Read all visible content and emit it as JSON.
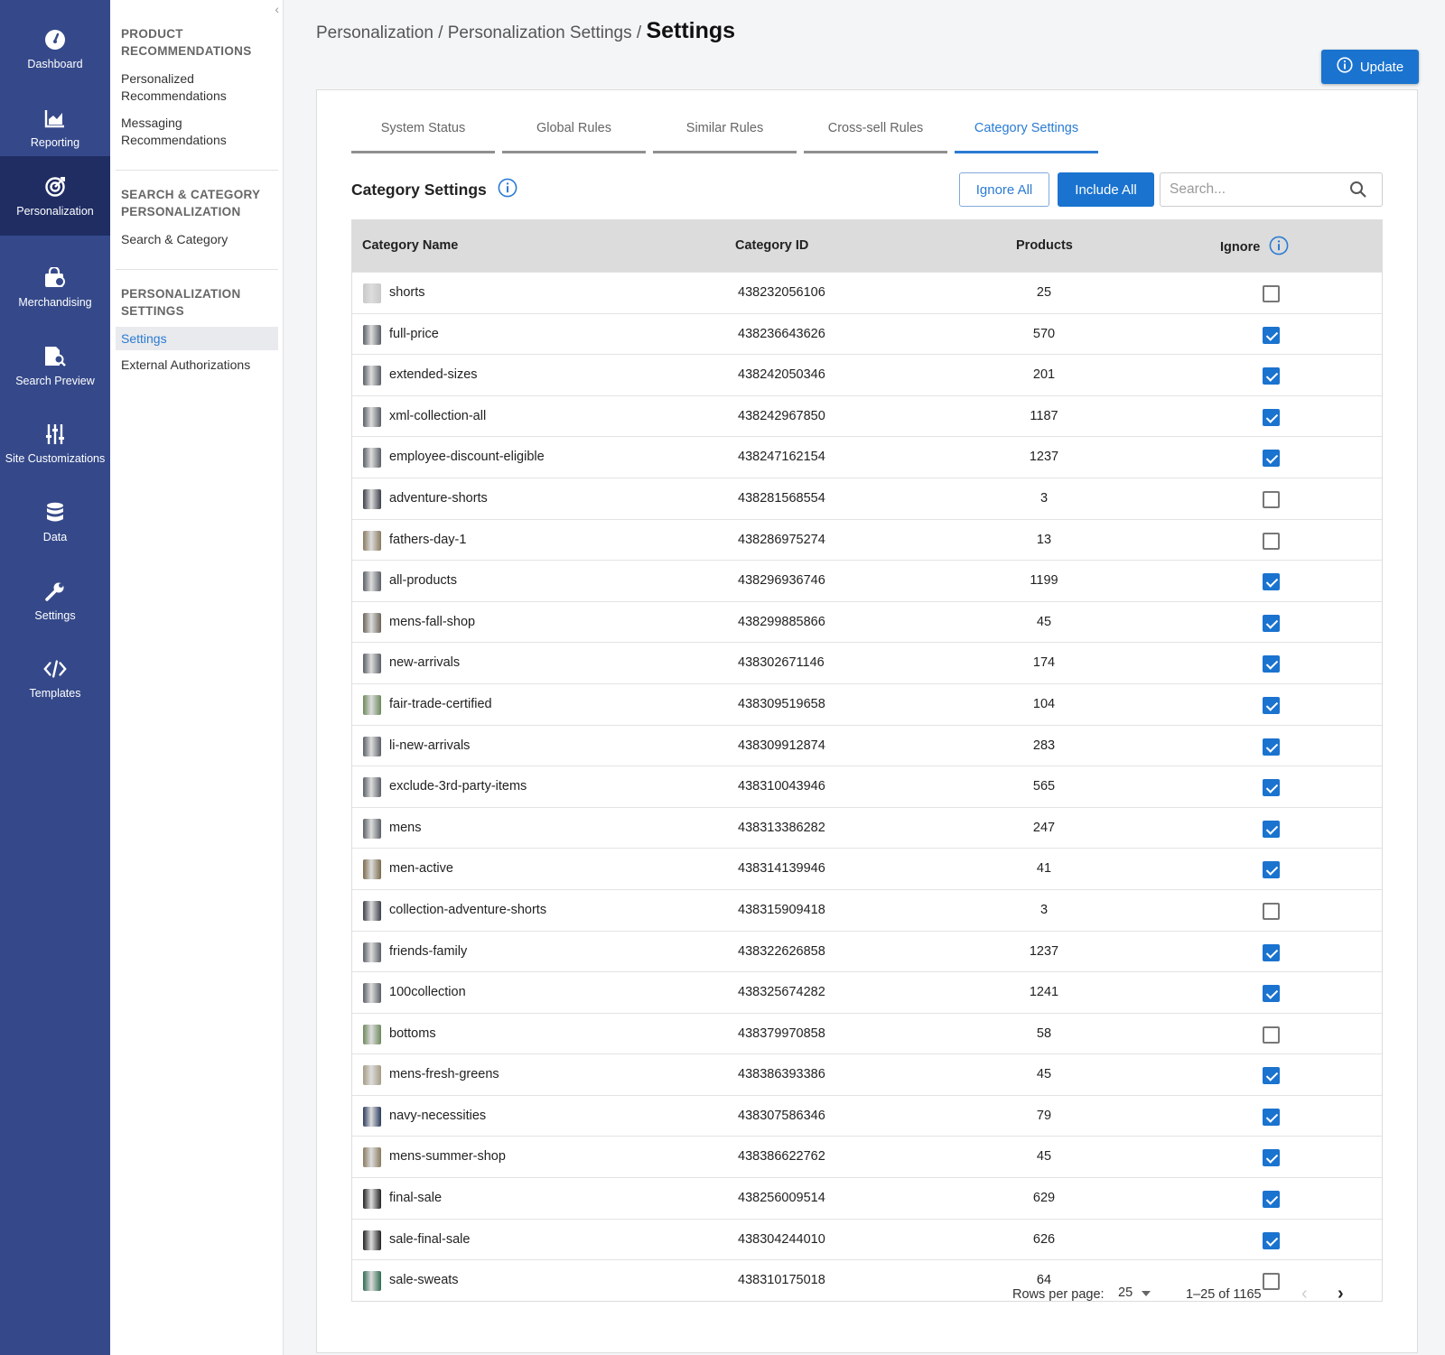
{
  "nav": {
    "items": [
      {
        "label": "Dashboard",
        "icon": "dashboard-gauge-icon"
      },
      {
        "label": "Reporting",
        "icon": "chart-icon"
      },
      {
        "label": "Personalization",
        "icon": "target-icon",
        "active": true
      },
      {
        "label": "Merchandising",
        "icon": "shopping-bag-icon"
      },
      {
        "label": "Search Preview",
        "icon": "search-document-icon"
      },
      {
        "label": "Site Customizations",
        "icon": "sliders-icon"
      },
      {
        "label": "Data",
        "icon": "database-icon"
      },
      {
        "label": "Settings",
        "icon": "wrench-icon"
      },
      {
        "label": "Templates",
        "icon": "code-icon"
      }
    ]
  },
  "submenu": {
    "sections": [
      {
        "heading": "PRODUCT RECOMMENDATIONS",
        "links": [
          "Personalized Recommendations",
          "Messaging Recommendations"
        ]
      },
      {
        "heading": "SEARCH & CATEGORY PERSONALIZATION",
        "links": [
          "Search & Category"
        ]
      },
      {
        "heading": "PERSONALIZATION SETTINGS",
        "links": [
          "Settings",
          "External Authorizations"
        ]
      }
    ],
    "active_link": "Settings"
  },
  "breadcrumb": {
    "path": "Personalization / Personalization Settings / ",
    "current": "Settings"
  },
  "update_button": "Update",
  "tabs": [
    "System Status",
    "Global Rules",
    "Similar Rules",
    "Cross-sell Rules",
    "Category Settings"
  ],
  "active_tab": "Category Settings",
  "section_title": "Category Settings",
  "actions": {
    "ignore_all": "Ignore All",
    "include_all": "Include All"
  },
  "search": {
    "placeholder": "Search...",
    "value": ""
  },
  "table": {
    "columns": [
      "Category Name",
      "Category ID",
      "Products",
      "Ignore"
    ],
    "rows": [
      {
        "name": "shorts",
        "id": "438232056106",
        "products": "25",
        "ignore": false,
        "thumb": "#c8c8c8"
      },
      {
        "name": "full-price",
        "id": "438236643626",
        "products": "570",
        "ignore": true,
        "thumb": "#5a5f66"
      },
      {
        "name": "extended-sizes",
        "id": "438242050346",
        "products": "201",
        "ignore": true,
        "thumb": "#5a5f66"
      },
      {
        "name": "xml-collection-all",
        "id": "438242967850",
        "products": "1187",
        "ignore": true,
        "thumb": "#5a5f66"
      },
      {
        "name": "employee-discount-eligible",
        "id": "438247162154",
        "products": "1237",
        "ignore": true,
        "thumb": "#5a5f66"
      },
      {
        "name": "adventure-shorts",
        "id": "438281568554",
        "products": "3",
        "ignore": false,
        "thumb": "#3b3f48"
      },
      {
        "name": "fathers-day-1",
        "id": "438286975274",
        "products": "13",
        "ignore": false,
        "thumb": "#8a7a5e"
      },
      {
        "name": "all-products",
        "id": "438296936746",
        "products": "1199",
        "ignore": true,
        "thumb": "#5a5f66"
      },
      {
        "name": "mens-fall-shop",
        "id": "438299885866",
        "products": "45",
        "ignore": true,
        "thumb": "#6a6457"
      },
      {
        "name": "new-arrivals",
        "id": "438302671146",
        "products": "174",
        "ignore": true,
        "thumb": "#5a5f66"
      },
      {
        "name": "fair-trade-certified",
        "id": "438309519658",
        "products": "104",
        "ignore": true,
        "thumb": "#6d8a5c"
      },
      {
        "name": "li-new-arrivals",
        "id": "438309912874",
        "products": "283",
        "ignore": true,
        "thumb": "#5a5f66"
      },
      {
        "name": "exclude-3rd-party-items",
        "id": "438310043946",
        "products": "565",
        "ignore": true,
        "thumb": "#5a5f66"
      },
      {
        "name": "mens",
        "id": "438313386282",
        "products": "247",
        "ignore": true,
        "thumb": "#5a5f66"
      },
      {
        "name": "men-active",
        "id": "438314139946",
        "products": "41",
        "ignore": true,
        "thumb": "#7a6b4c"
      },
      {
        "name": "collection-adventure-shorts",
        "id": "438315909418",
        "products": "3",
        "ignore": false,
        "thumb": "#3b3f48"
      },
      {
        "name": "friends-family",
        "id": "438322626858",
        "products": "1237",
        "ignore": true,
        "thumb": "#5a5f66"
      },
      {
        "name": "100collection",
        "id": "438325674282",
        "products": "1241",
        "ignore": true,
        "thumb": "#5a5f66"
      },
      {
        "name": "bottoms",
        "id": "438379970858",
        "products": "58",
        "ignore": false,
        "thumb": "#6d8a5c"
      },
      {
        "name": "mens-fresh-greens",
        "id": "438386393386",
        "products": "45",
        "ignore": true,
        "thumb": "#a59c85"
      },
      {
        "name": "navy-necessities",
        "id": "438307586346",
        "products": "79",
        "ignore": true,
        "thumb": "#2a3c5e"
      },
      {
        "name": "mens-summer-shop",
        "id": "438386622762",
        "products": "45",
        "ignore": true,
        "thumb": "#8a7a5e"
      },
      {
        "name": "final-sale",
        "id": "438256009514",
        "products": "629",
        "ignore": true,
        "thumb": "#222222"
      },
      {
        "name": "sale-final-sale",
        "id": "438304244010",
        "products": "626",
        "ignore": true,
        "thumb": "#222222"
      },
      {
        "name": "sale-sweats",
        "id": "438310175018",
        "products": "64",
        "ignore": false,
        "thumb": "#2e6b50"
      }
    ]
  },
  "pagination": {
    "rows_per_page_label": "Rows per page:",
    "rows_per_page": "25",
    "range": "1–25 of 1165"
  },
  "colors": {
    "nav_bg": "#35498a",
    "nav_active": "#1f2d63",
    "accent": "#1a73cf"
  }
}
